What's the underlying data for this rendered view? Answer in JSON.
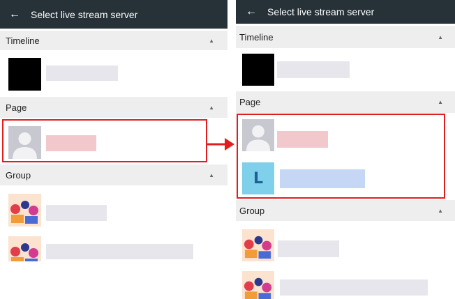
{
  "screens": [
    {
      "app_bar": {
        "title": "Select live stream server",
        "back_icon": "arrow-left-icon"
      },
      "sections": [
        {
          "label": "Timeline",
          "caret_icon": "triangle-up-icon"
        },
        {
          "label": "Page",
          "caret_icon": "triangle-up-icon"
        },
        {
          "label": "Group",
          "caret_icon": "triangle-up-icon"
        }
      ]
    },
    {
      "app_bar": {
        "title": "Select live stream server",
        "back_icon": "arrow-left-icon"
      },
      "sections": [
        {
          "label": "Timeline",
          "caret_icon": "triangle-up-icon"
        },
        {
          "label": "Page",
          "caret_icon": "triangle-up-icon"
        },
        {
          "label": "Group",
          "caret_icon": "triangle-up-icon"
        }
      ],
      "new_page_avatar_letter": "L"
    }
  ],
  "colors": {
    "app_bar": "#263238",
    "section_header": "#eeeeee",
    "highlight": "#e11e1e",
    "redacted_gray": "#e6e6ec",
    "redacted_pink": "#f3c8cc",
    "redacted_blue": "#c5d7f4",
    "page_avatar_L_bg": "#7fd0ea",
    "page_avatar_L_fg": "#1f5f94"
  }
}
